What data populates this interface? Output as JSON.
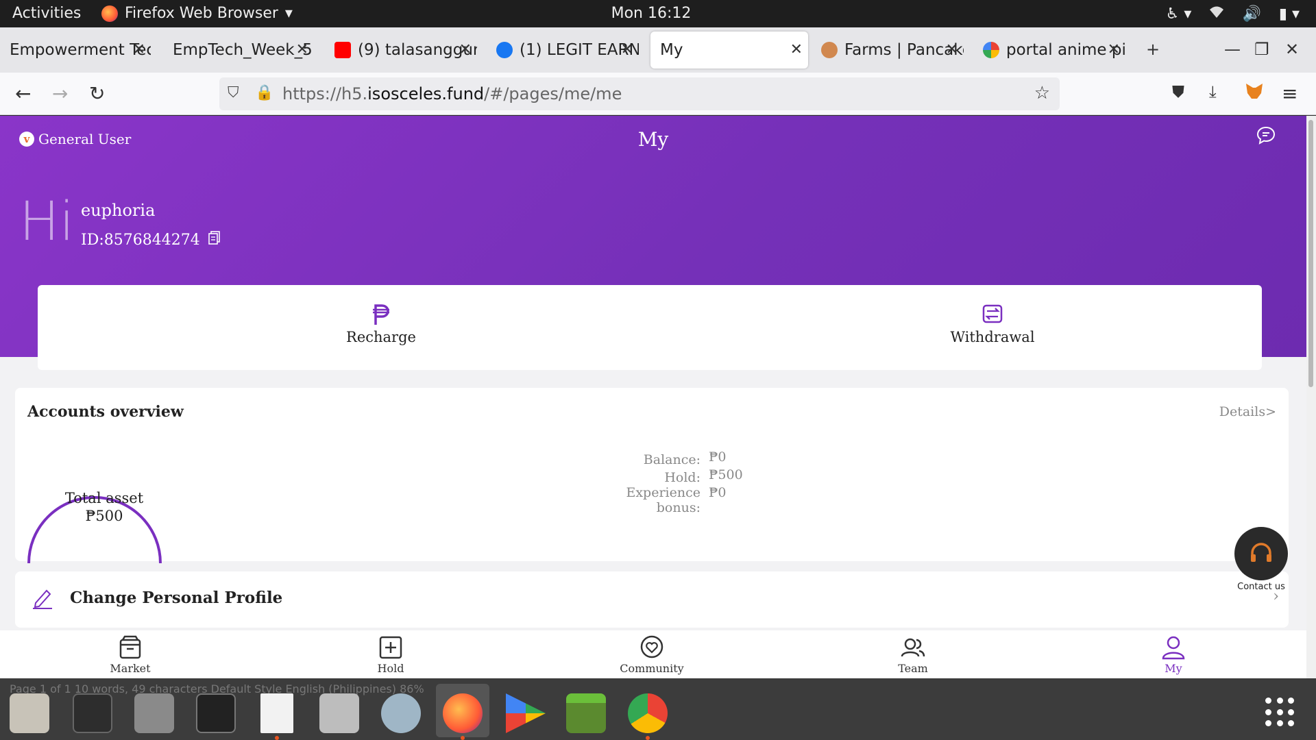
{
  "topbar": {
    "activities": "Activities",
    "app_name": "Firefox Web Browser",
    "clock": "Mon 16:12"
  },
  "tabs": [
    {
      "label": "Empowerment Tec",
      "favicon": "document-icon",
      "active": false
    },
    {
      "label": "EmpTech_Week_5",
      "favicon": "none",
      "active": false
    },
    {
      "label": "(9) talasanggur",
      "favicon": "youtube-icon",
      "active": false
    },
    {
      "label": "(1) LEGIT EARN",
      "favicon": "facebook-icon",
      "active": false
    },
    {
      "label": "My",
      "favicon": "none",
      "active": true
    },
    {
      "label": "Farms | Pancake",
      "favicon": "pancake-icon",
      "active": false
    },
    {
      "label": "portal anime pi",
      "favicon": "google-icon",
      "active": false
    }
  ],
  "navbar": {
    "url_prefix": "https://h5.",
    "url_domain": "isosceles.fund",
    "url_path": "/#/pages/me/me"
  },
  "page": {
    "title": "My",
    "user_type": "General User",
    "greeting": "Hi",
    "username": "euphoria",
    "user_id": "ID:8576844274",
    "recharge_label": "Recharge",
    "withdrawal_label": "Withdrawal",
    "accounts": {
      "heading": "Accounts overview",
      "details_link": "Details>",
      "total_label": "Total asset",
      "total_value": "₱500",
      "rows": [
        {
          "label": "Balance:",
          "value": "₱0"
        },
        {
          "label": "Hold:",
          "value": "₱500"
        },
        {
          "label": "Experience",
          "label2": "bonus:",
          "value": "₱0"
        }
      ]
    },
    "profile_label": "Change Personal Profile",
    "contact_label": "Contact us",
    "accent_color": "#7a2fc0"
  },
  "bottom_nav": [
    {
      "label": "Market",
      "icon": "market-icon",
      "active": false
    },
    {
      "label": "Hold",
      "icon": "hold-icon",
      "active": false
    },
    {
      "label": "Community",
      "icon": "community-icon",
      "active": false
    },
    {
      "label": "Team",
      "icon": "team-icon",
      "active": false
    },
    {
      "label": "My",
      "icon": "user-icon",
      "active": true
    }
  ],
  "dock": {
    "background_text": "Page 1 of 1    10 words, 49 characters    Default Style    English (Philippines)    86%"
  }
}
